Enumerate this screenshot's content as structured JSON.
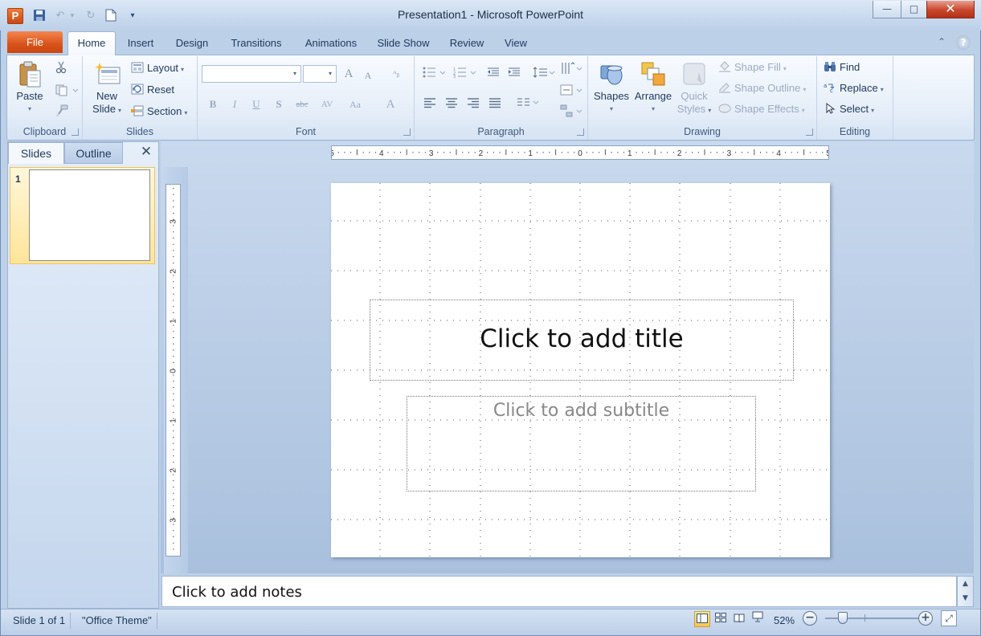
{
  "window": {
    "app_letter": "P",
    "title": "Presentation1  -  Microsoft PowerPoint",
    "minimize_glyph": "—",
    "maximize_glyph": "□",
    "close_glyph": "✕"
  },
  "quick_access": {
    "save_glyph": "▪",
    "undo_glyph": "↶",
    "undo_dropdown": "▾",
    "redo_glyph": "↻",
    "new_glyph": "▫",
    "customize_glyph": "▾"
  },
  "ribbon_tabs": {
    "file": "File",
    "tabs": [
      "Home",
      "Insert",
      "Design",
      "Transitions",
      "Animations",
      "Slide Show",
      "Review",
      "View"
    ],
    "active": "Home",
    "minimize_glyph": "⌃",
    "help_glyph": "?"
  },
  "clipboard": {
    "paste": "Paste",
    "caret": "▾",
    "cut_icon": "scissors-icon",
    "copy_icon": "copy-icon",
    "format_painter_icon": "paintbrush-icon",
    "label": "Clipboard"
  },
  "slides_group": {
    "new_slide_line1": "New",
    "new_slide_line2": "Slide",
    "layout": "Layout",
    "reset": "Reset",
    "section": "Section",
    "label": "Slides"
  },
  "font_group": {
    "font_name": "",
    "font_size": "",
    "grow": "A",
    "shrink": "A",
    "clear": "ᴬᵦ",
    "bold": "B",
    "italic": "I",
    "underline": "U",
    "shadow": "S",
    "strike": "abc",
    "spacing": "AV",
    "case": "Aa",
    "color": "A",
    "label": "Font"
  },
  "paragraph_group": {
    "label": "Paragraph"
  },
  "drawing_group": {
    "shapes": "Shapes",
    "arrange": "Arrange",
    "quick_styles_line1": "Quick",
    "quick_styles_line2": "Styles",
    "shape_fill": "Shape Fill",
    "shape_outline": "Shape Outline",
    "shape_effects": "Shape Effects",
    "label": "Drawing"
  },
  "editing_group": {
    "find": "Find",
    "replace": "Replace",
    "select": "Select",
    "label": "Editing"
  },
  "left_pane": {
    "slides_tab": "Slides",
    "outline_tab": "Outline",
    "close_glyph": "✕",
    "thumb_number": "1"
  },
  "rulers": {
    "horizontal": [
      "5",
      "4",
      "3",
      "2",
      "1",
      "0",
      "1",
      "2",
      "3",
      "4",
      "5"
    ],
    "vertical": [
      "3",
      "2",
      "1",
      "0",
      "1",
      "2",
      "3"
    ]
  },
  "slide": {
    "title_placeholder": "Click to add title",
    "subtitle_placeholder": "Click to add subtitle"
  },
  "notes": {
    "placeholder": "Click to add notes",
    "up_glyph": "▲",
    "down_glyph": "▼"
  },
  "status": {
    "slide_info": "Slide 1 of 1",
    "theme": "\"Office Theme\"",
    "zoom_pct": "52%",
    "zoom_level_percent": 52,
    "zoom_out": "−",
    "zoom_in": "+",
    "fit_glyph": "⤢"
  },
  "colors": {
    "file_tab": "#d9531b",
    "ribbon_bg": "#e4edf8",
    "accent_selected": "#f8c548"
  }
}
